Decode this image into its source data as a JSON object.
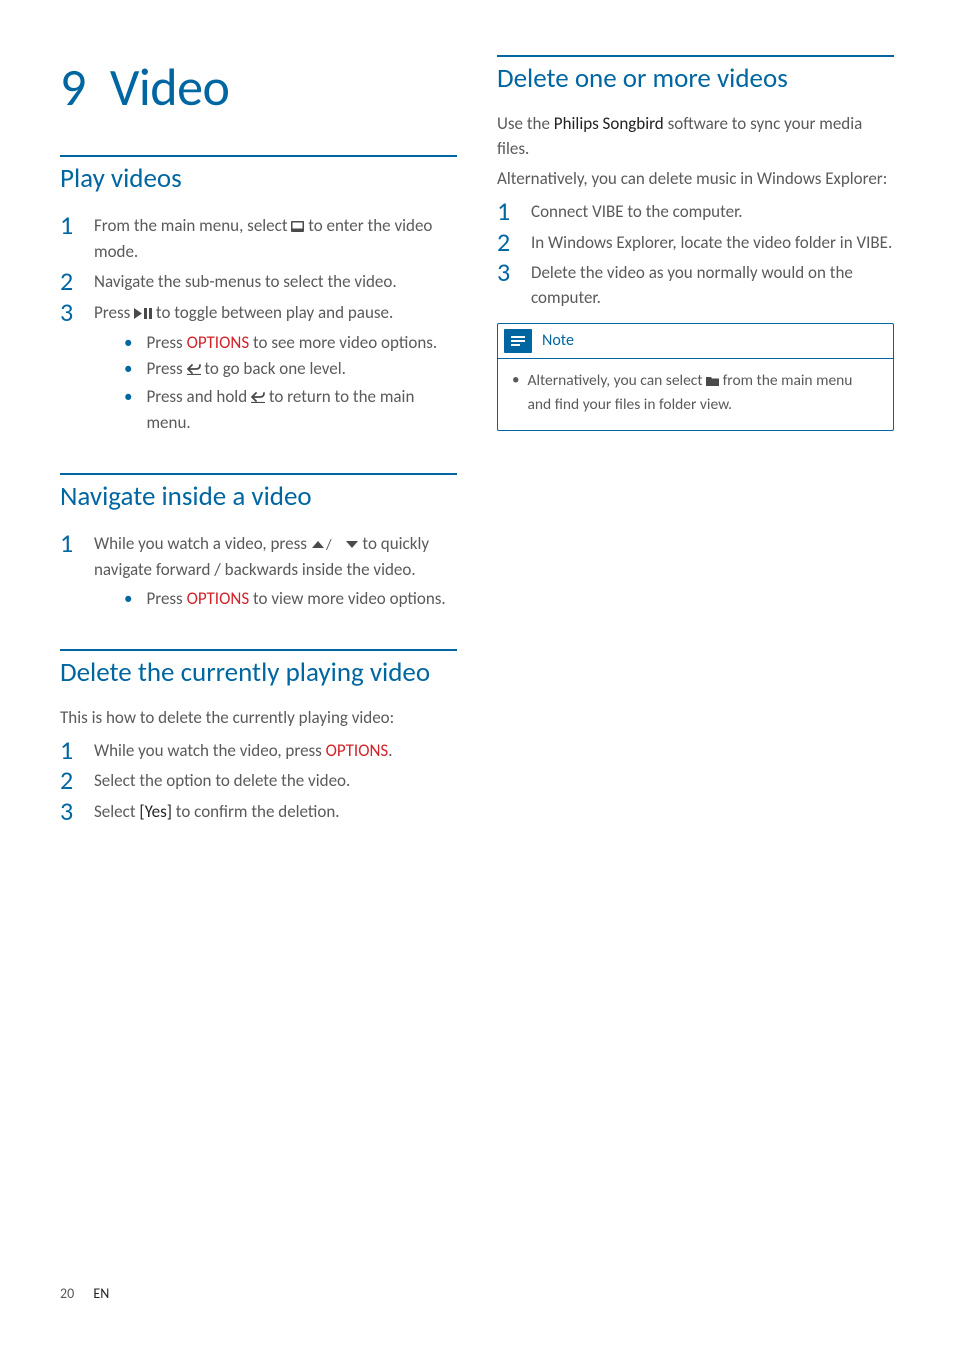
{
  "chapter": {
    "number": "9",
    "title": "Video"
  },
  "left": {
    "sections": [
      {
        "title": "Play videos",
        "steps": [
          {
            "num": "1",
            "text_before": "From the main menu, select ",
            "icon": "video",
            "text_after": " to enter the video mode."
          },
          {
            "num": "2",
            "text": "Navigate the sub-menus to select the video."
          },
          {
            "num": "3",
            "text_before": "Press ",
            "icon": "playpause",
            "text_after": " to toggle between play and pause.",
            "bullets": [
              {
                "pre": "Press ",
                "key": "OPTIONS",
                "post": " to see more video options."
              },
              {
                "pre": "Press ",
                "icon": "back",
                "post": " to go back one level."
              },
              {
                "pre": "Press and hold ",
                "icon": "back",
                "post": " to return to the main menu."
              }
            ]
          }
        ]
      },
      {
        "title": "Navigate inside a video",
        "steps": [
          {
            "num": "1",
            "text_before": "While you watch a video, press ",
            "icon": "updown",
            "text_after": " to quickly navigate forward / backwards inside the video.",
            "bullets": [
              {
                "pre": "Press ",
                "key": "OPTIONS",
                "post": " to view more video options."
              }
            ]
          }
        ]
      },
      {
        "title": "Delete the currently playing video",
        "intro": "This is how to delete the currently playing video:",
        "steps": [
          {
            "num": "1",
            "text_before": "While you watch the video, press ",
            "key_after": "OPTIONS",
            "post_after": "."
          },
          {
            "num": "2",
            "text": "Select the option to delete the video."
          },
          {
            "num": "3",
            "text_before": "Select ",
            "bold": "[Yes]",
            "text_after": " to confirm the deletion."
          }
        ]
      }
    ]
  },
  "right": {
    "section": {
      "title": "Delete one or more videos",
      "intro1_pre": "Use the ",
      "intro1_bold": "Philips Songbird",
      "intro1_post": " software to sync your media files.",
      "intro2": "Alternatively, you can delete music in Windows Explorer:",
      "steps": [
        {
          "num": "1",
          "text": "Connect VIBE to the computer."
        },
        {
          "num": "2",
          "text": "In Windows Explorer, locate the video folder in VIBE."
        },
        {
          "num": "3",
          "text": "Delete the video as you normally would on the computer."
        }
      ],
      "note": {
        "label": "Note",
        "text_pre": "Alternatively, you can select ",
        "icon": "folder",
        "text_post": " from the main menu and find your files in folder view."
      }
    }
  },
  "footer": {
    "page": "20",
    "lang": "EN"
  }
}
